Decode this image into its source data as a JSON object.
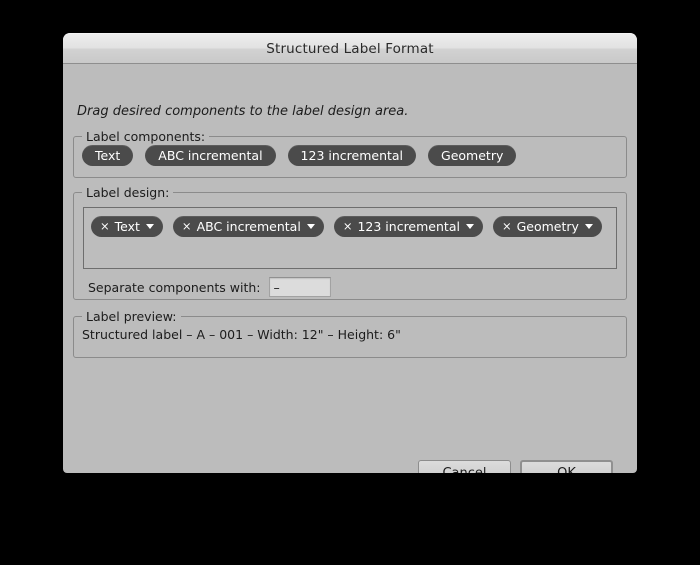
{
  "window": {
    "title": "Structured Label Format"
  },
  "instruction": "Drag desired components to the label design area.",
  "components_group": {
    "legend": "Label components:",
    "items": [
      {
        "label": "Text"
      },
      {
        "label": "ABC incremental"
      },
      {
        "label": "123 incremental"
      },
      {
        "label": "Geometry"
      }
    ]
  },
  "design_group": {
    "legend": "Label design:",
    "items": [
      {
        "close": "×",
        "label": "Text"
      },
      {
        "close": "×",
        "label": "ABC incremental"
      },
      {
        "close": "×",
        "label": "123 incremental"
      },
      {
        "close": "×",
        "label": "Geometry"
      }
    ],
    "separator": {
      "label": "Separate components with:",
      "value": "–"
    }
  },
  "preview_group": {
    "legend": "Label preview:",
    "text": "Structured label – A – 001 – Width: 12\" – Height: 6\""
  },
  "buttons": {
    "cancel": "Cancel",
    "ok": "OK"
  },
  "colors": {
    "dialog_background": "#bcbcbc",
    "pill_background": "#4b4b4b",
    "pill_text": "#ffffff",
    "titlebar_top": "#ededed",
    "titlebar_bottom": "#c9c9c9",
    "text": "#1c1c1c"
  }
}
